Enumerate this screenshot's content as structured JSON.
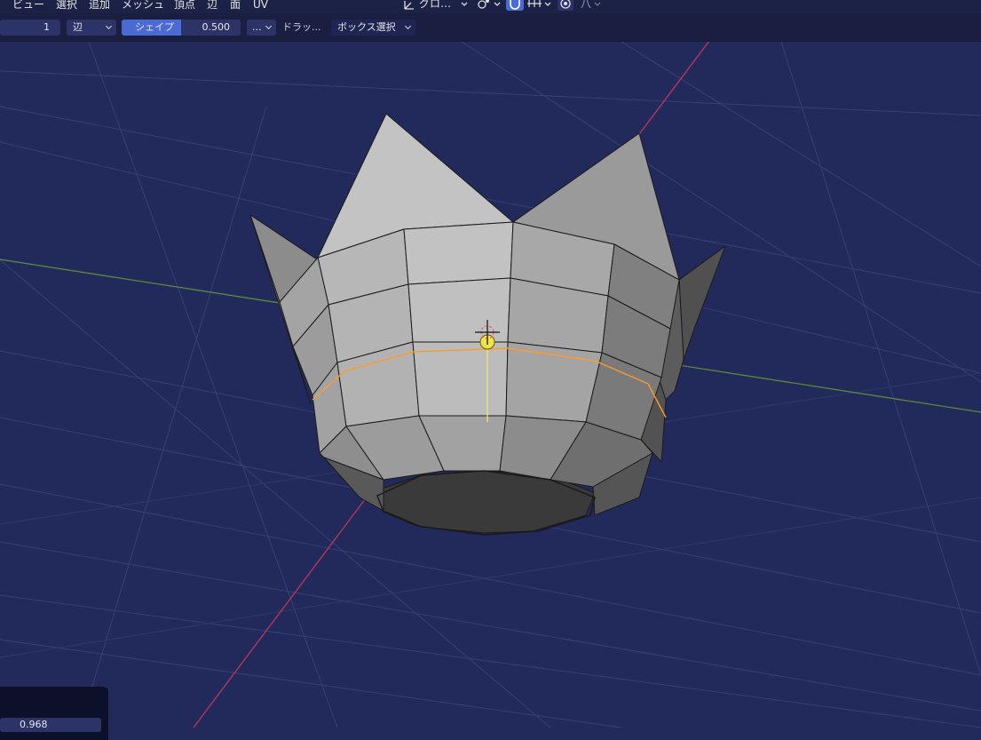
{
  "menu": {
    "items": [
      {
        "label": "ビュー"
      },
      {
        "label": "選択"
      },
      {
        "label": "追加"
      },
      {
        "label": "メッシュ"
      },
      {
        "label": "頂点"
      },
      {
        "label": "辺"
      },
      {
        "label": "面"
      },
      {
        "label": "UV"
      }
    ]
  },
  "header": {
    "transform_orientation": "グロ…",
    "proportional_label": "八"
  },
  "operator": {
    "number_cuts": "1",
    "select_mode": "辺",
    "shape_label": "シェイプ",
    "shape_value": "0.500",
    "more_label": "...",
    "drag_label": "ドラッ...",
    "box_select": "ボックス選択"
  },
  "panel": {
    "value": "0.968"
  },
  "icons": {
    "transform_pivot": "pivot-point-icon",
    "snap": "snap-magnet-icon",
    "snap_increment": "snap-increment-icon",
    "proportional": "proportional-editing-icon",
    "gizmo": "object-origin-gizmo-icon"
  },
  "colors": {
    "viewport_bg": "#212a5a",
    "grid": "#3a4377",
    "x_axis": "#b23a5a",
    "y_axis": "#5a8a3a",
    "selection": "#ff9a2a",
    "active_field": "#4a6bd3",
    "mesh_light": "#c4c4c4",
    "mesh_dark": "#474747"
  }
}
